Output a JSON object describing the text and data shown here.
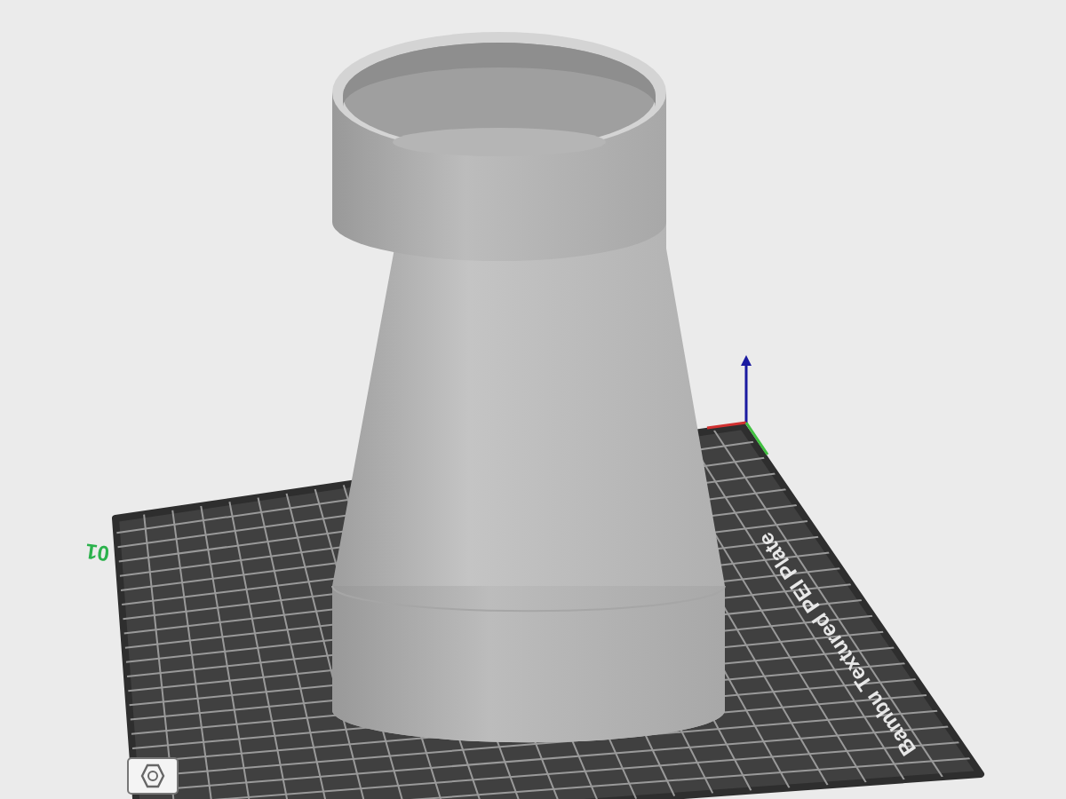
{
  "plate": {
    "number": "01",
    "label": "Bambu Textured PEI Plate"
  }
}
